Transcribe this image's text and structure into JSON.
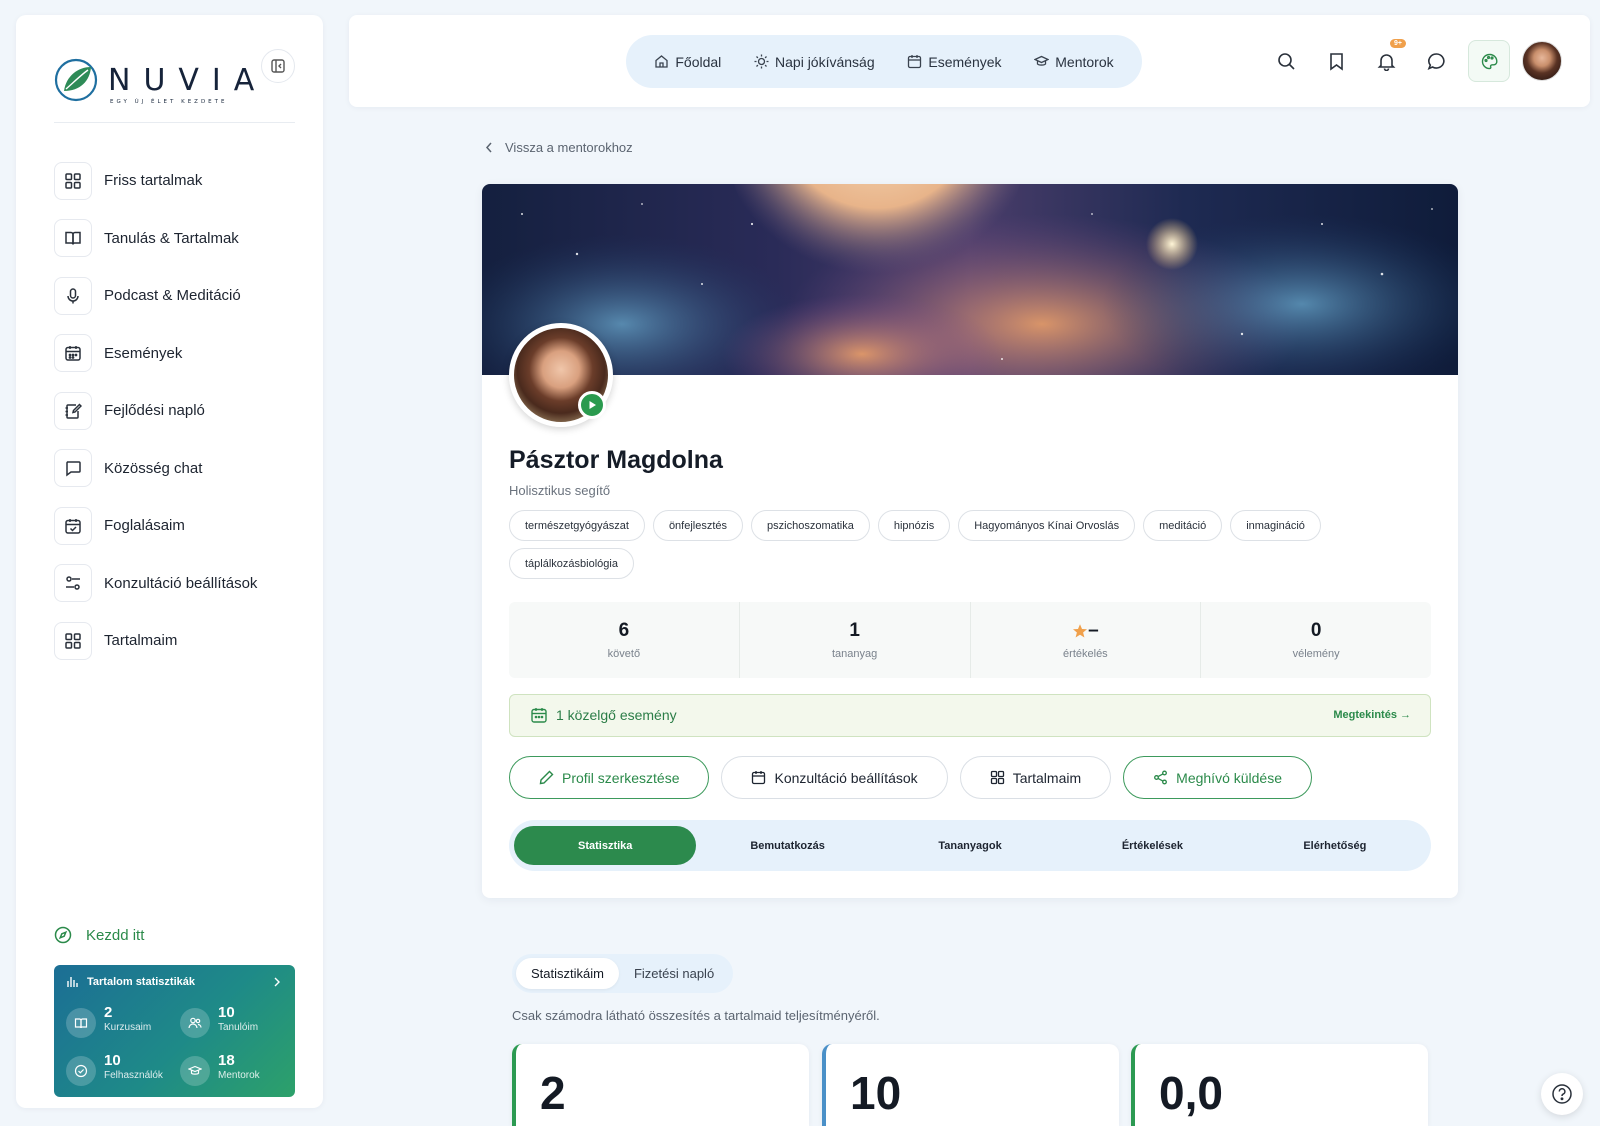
{
  "brand": {
    "name": "NUVIA",
    "tagline": "EGY ÚJ ÉLET KEZDETE"
  },
  "sidebar": {
    "items": [
      {
        "label": "Friss tartalmak",
        "icon": "grid-icon"
      },
      {
        "label": "Tanulás & Tartalmak",
        "icon": "book-open-icon"
      },
      {
        "label": "Podcast & Meditáció",
        "icon": "microphone-icon"
      },
      {
        "label": "Események",
        "icon": "calendar-icon"
      },
      {
        "label": "Fejlődési napló",
        "icon": "journal-edit-icon"
      },
      {
        "label": "Közösség chat",
        "icon": "chat-bubble-icon"
      },
      {
        "label": "Foglalásaim",
        "icon": "calendar-check-icon"
      },
      {
        "label": "Konzultáció beállítások",
        "icon": "sliders-icon"
      },
      {
        "label": "Tartalmaim",
        "icon": "grid-icon"
      }
    ],
    "start_label": "Kezdd itt",
    "stats_card": {
      "title": "Tartalom statisztikák",
      "items": [
        {
          "value": "2",
          "label": "Kurzusaim"
        },
        {
          "value": "10",
          "label": "Tanulóim"
        },
        {
          "value": "10",
          "label": "Felhasználók"
        },
        {
          "value": "18",
          "label": "Mentorok"
        }
      ]
    }
  },
  "topnav": {
    "items": [
      {
        "label": "Főoldal",
        "icon": "home-icon"
      },
      {
        "label": "Napi jókívánság",
        "icon": "sun-icon"
      },
      {
        "label": "Események",
        "icon": "calendar-icon"
      },
      {
        "label": "Mentorok",
        "icon": "graduation-cap-icon"
      }
    ],
    "notification_badge": "9+"
  },
  "back_link": "Vissza a mentorokhoz",
  "profile": {
    "name": "Pásztor Magdolna",
    "role": "Holisztikus segítő",
    "tags": [
      "természetgyógyászat",
      "önfejlesztés",
      "pszichoszomatika",
      "hipnózis",
      "Hagyományos Kínai Orvoslás",
      "meditáció",
      "inmagináció",
      "táplálkozásbiológia"
    ],
    "stats": [
      {
        "value": "6",
        "label": "követő"
      },
      {
        "value": "1",
        "label": "tananyag"
      },
      {
        "value": "–",
        "label": "értékelés"
      },
      {
        "value": "0",
        "label": "vélemény"
      }
    ],
    "event_text": "1 közelgő esemény",
    "event_link": "Megtekintés →",
    "actions": [
      "Profil szerkesztése",
      "Konzultáció beállítások",
      "Tartalmaim",
      "Meghívó küldése"
    ],
    "tabs": [
      "Statisztika",
      "Bemutatkozás",
      "Tananyagok",
      "Értékelések",
      "Elérhetőség"
    ],
    "active_tab": "Statisztika"
  },
  "stats_section": {
    "tabs": [
      "Statisztikáim",
      "Fizetési napló"
    ],
    "description": "Csak számodra látható összesítés a tartalmaid teljesítményéről.",
    "kpis": [
      "2",
      "10",
      "0,0"
    ]
  },
  "colors": {
    "accent": "#2c8a4d",
    "nav_bg": "#e6f1fb",
    "badge": "#f0a04b"
  }
}
